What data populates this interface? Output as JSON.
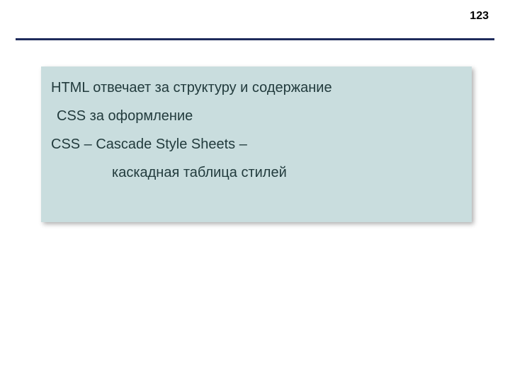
{
  "header": {
    "page_number": "123"
  },
  "content": {
    "line1": "HTML отвечает за структуру и содержание",
    "line2": "CSS за оформление",
    "line3": "CSS – Cascade Style Sheets –",
    "line4": "каскадная таблица стилей"
  }
}
